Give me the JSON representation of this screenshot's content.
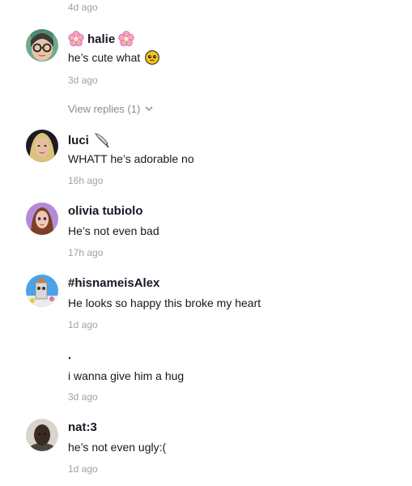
{
  "top_timestamp": "4d ago",
  "comments": [
    {
      "username": "halie",
      "text": "he’s cute what",
      "time": "3d ago",
      "replies_label": "View replies (1)"
    },
    {
      "username": "luci",
      "text": "WHATT he’s adorable no",
      "time": "16h ago"
    },
    {
      "username": "olivia tubiolo",
      "text": "He’s not even bad",
      "time": "17h ago"
    },
    {
      "username": "#hisnameisAlex",
      "text": "He looks so happy this broke my heart",
      "time": "1d ago"
    },
    {
      "username": ".",
      "text": "i wanna give him a hug",
      "time": "3d ago"
    },
    {
      "username": "nat:3",
      "text": "he’s not even ugly:(",
      "time": "1d ago"
    }
  ],
  "icons": {
    "c0_name_prefix": "cherry-blossom-icon",
    "c0_name_suffix": "cherry-blossom-icon",
    "c0_text_emoji": "pleading-face-icon",
    "c0_replies_chevron": "chevron-down-icon",
    "c1_name_suffix": "feather-pen-icon"
  },
  "colors": {
    "text_primary": "#161823",
    "text_secondary": "#a0a1a8",
    "replies_text": "#8a8b91"
  }
}
